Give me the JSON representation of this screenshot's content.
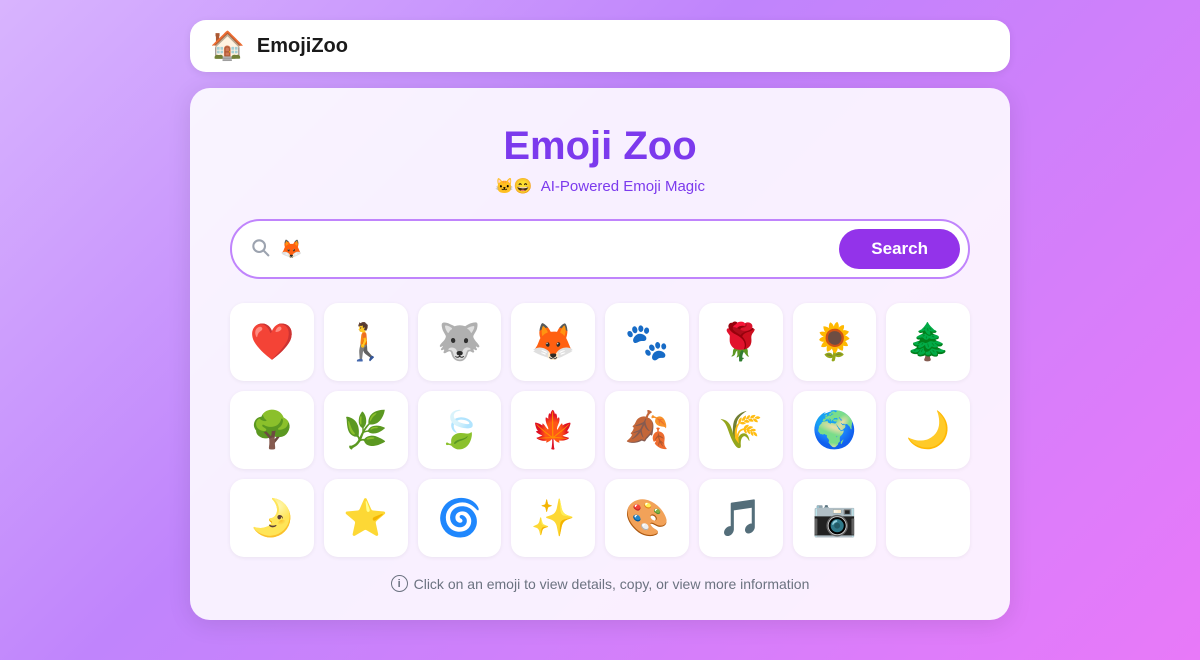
{
  "navbar": {
    "logo": "🏠",
    "title": "EmojiZoo"
  },
  "main": {
    "title": "Emoji Zoo",
    "subtitle_emoji": "🐱😄",
    "subtitle_text": "AI-Powered Emoji Magic",
    "search": {
      "placeholder": "🦊",
      "button_label": "Search"
    },
    "footer_hint": "Click on an emoji to view details, copy, or view more information",
    "emoji_rows": [
      [
        "❤️",
        "🚶",
        "🐺",
        "🦊",
        "🐾",
        "🌹",
        "🌻",
        "🌲"
      ],
      [
        "🌳",
        "🌿",
        "🍃",
        "🍁",
        "🍂",
        "🌾",
        "🌍",
        "🌙"
      ],
      [
        "🌛",
        "⭐",
        "🌀",
        "✨",
        "🎨",
        "🎵",
        "📷",
        ""
      ]
    ]
  }
}
